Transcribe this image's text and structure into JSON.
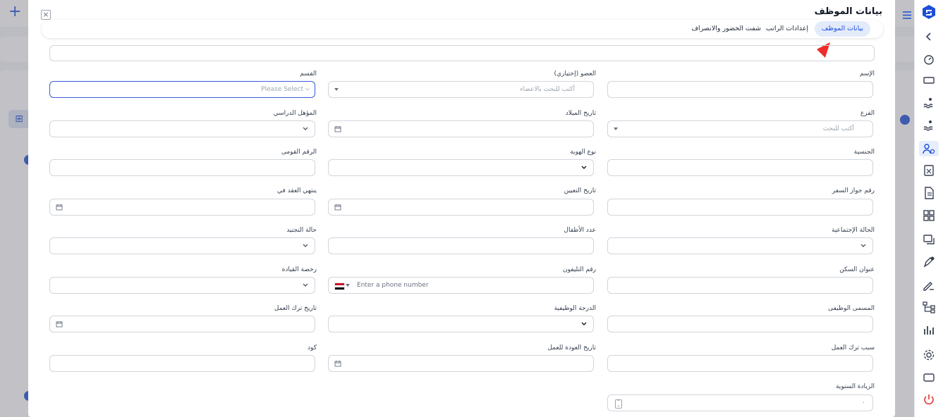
{
  "modal": {
    "title": "بيانات الموظف",
    "tabs": [
      "بيانات الموظف",
      "إعدادات الراتب",
      "شفت الحضور والانصراف"
    ]
  },
  "fields": {
    "name_label": "الإسم",
    "member_label": "العضو (إختياري)",
    "member_placeholder": "أكتب للبحث بالاعضاء",
    "department_label": "القسم",
    "department_placeholder": "Please Select",
    "branch_label": "الفرع",
    "branch_placeholder": "أكتب للبحث",
    "birth_date_label": "تاريخ الميلاد",
    "qualification_label": "المؤهل الدراسي",
    "nationality_label": "الجنسية",
    "id_type_label": "نوع الهوية",
    "national_id_label": "الرقم القومى",
    "passport_label": "رقم جواز السفر",
    "hire_date_label": "تاريخ التعيين",
    "contract_end_label": "ينتهي العقد في",
    "marital_label": "الحالة الإجتماعية",
    "children_label": "عدد الأطفال",
    "military_label": "حالة التجنيد",
    "address_label": "عنوان السكن",
    "phone_label": "رقم التليفون",
    "phone_placeholder": "Enter a phone number",
    "license_label": "رخصة القيادة",
    "job_title_label": "المسمى الوظيفى",
    "job_grade_label": "الدرجة الوظيفية",
    "leave_date_label": "تاريخ ترك العمل",
    "leave_reason_label": "سبب ترك العمل",
    "return_date_label": "تاريخ العودة للعمل",
    "code_label": "كود",
    "annual_raise_label": "الزيادة السنوية",
    "annual_raise_value": "٠"
  },
  "colors": {
    "accent": "#1d4ed8",
    "active_tab_bg": "#e3ebfb",
    "pointer": "#ef2b2b",
    "power_icon": "#dc2626"
  },
  "sidebar_icons": [
    "logo-icon",
    "chevron-left-icon",
    "dashboard-gauge-icon",
    "ticket-icon",
    "swimmer-icon",
    "swimmer-icon",
    "users-settings-icon",
    "calculator-icon",
    "document-icon",
    "apps-icon",
    "chat-icon",
    "pen-check-icon",
    "signature-icon",
    "hierarchy-icon",
    "bar-chart-icon",
    "gear-icon",
    "rectangle-icon",
    "power-icon"
  ]
}
